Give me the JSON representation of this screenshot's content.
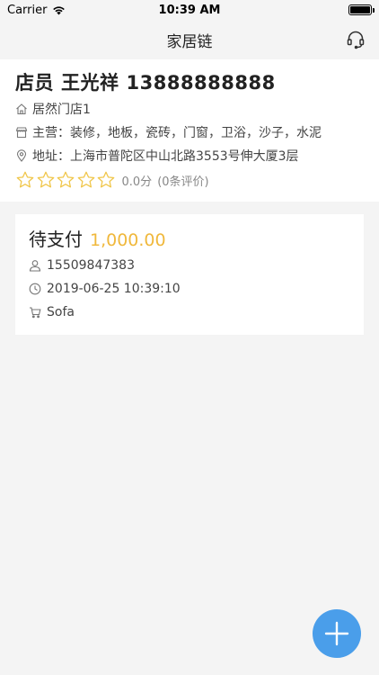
{
  "status_bar": {
    "carrier": "Carrier",
    "time": "10:39 AM"
  },
  "nav": {
    "title": "家居链",
    "right_icon": "headset-icon"
  },
  "store": {
    "role": "店员",
    "name": "王光祥",
    "phone": "13888888888",
    "shop_name": "居然门店1",
    "business_scope": "主营：装修，地板，瓷砖，门窗，卫浴，沙子，水泥",
    "address": "地址：上海市普陀区中山北路3553号伸大厦3层",
    "rating": {
      "stars_filled": 0,
      "stars_total": 5,
      "score": "0.0分",
      "count": "(0条评价)"
    }
  },
  "order": {
    "status": "待支付",
    "amount": "1,000.00",
    "customer_phone": "15509847383",
    "datetime": "2019-06-25 10:39:10",
    "product": "Sofa"
  },
  "colors": {
    "accent_amount": "#f0b83c",
    "star": "#f0c64a",
    "fab": "#4a9eea"
  }
}
